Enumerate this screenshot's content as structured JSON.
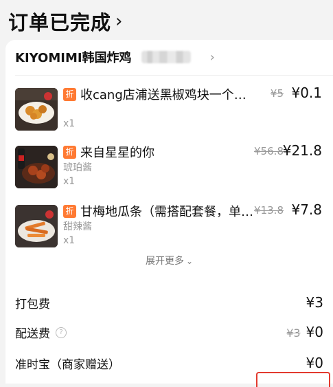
{
  "status": {
    "title": "订单已完成",
    "chevron": "›"
  },
  "shop": {
    "name": "KIYOMIMI韩国炸鸡",
    "chevron": "›"
  },
  "items": [
    {
      "discount_tag": "折",
      "title": "收cang店浦送黑椒鸡块一个（每…",
      "spec": "",
      "qty": "x1",
      "original_price": "¥5",
      "price": "¥0.1",
      "thumb": "chicken-nuggets"
    },
    {
      "discount_tag": "折",
      "title": "来自星星的你",
      "spec": "琥珀酱",
      "qty": "x1",
      "original_price": "¥56.8",
      "price": "¥21.8",
      "thumb": "fried-chicken-set"
    },
    {
      "discount_tag": "折",
      "title": "甘梅地瓜条（需搭配套餐，单…",
      "spec": "甜辣酱",
      "qty": "x1",
      "original_price": "¥13.8",
      "price": "¥7.8",
      "thumb": "sweet-potato-fries"
    }
  ],
  "expand_more": {
    "label": "展开更多",
    "chevron": "⌄"
  },
  "fees": {
    "packing": {
      "label": "打包费",
      "value": "¥3"
    },
    "delivery": {
      "label": "配送费",
      "help": "?",
      "original": "¥3",
      "value": "¥0"
    },
    "ontime": {
      "label": "准时宝（商家赠送）",
      "value": "¥0"
    }
  },
  "colors": {
    "discount_tag": "#ff7a33",
    "highlight": "#e23a2e"
  }
}
